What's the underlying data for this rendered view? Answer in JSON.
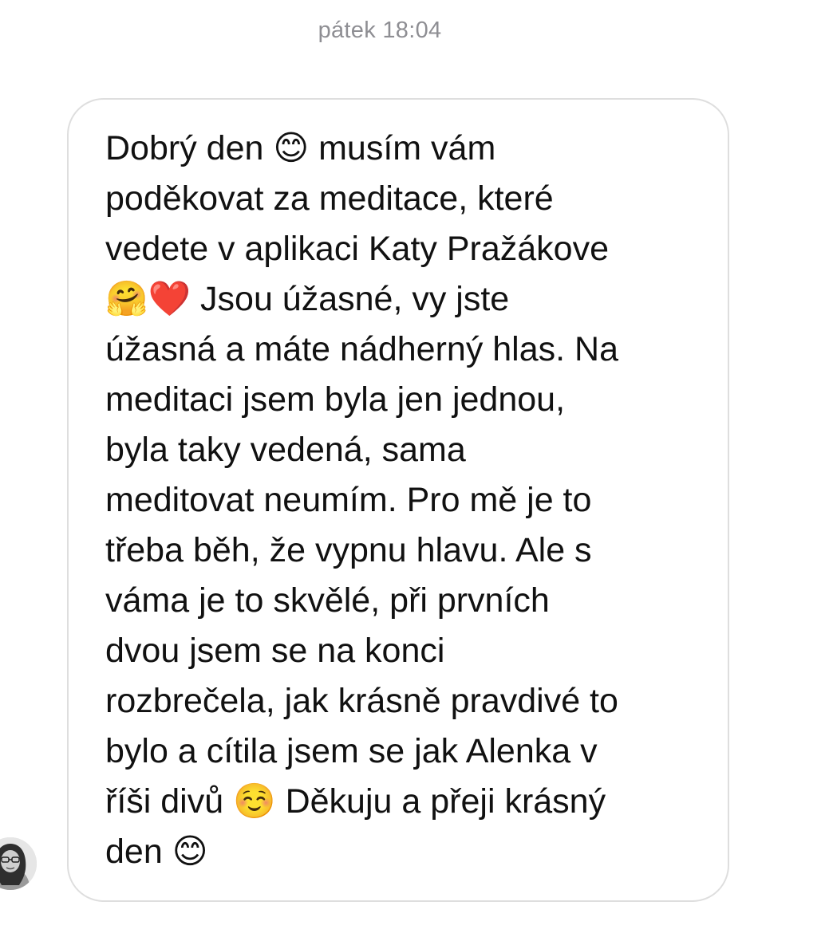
{
  "conversation": {
    "timestamp": "pátek 18:04",
    "message": {
      "text": "Dobrý den 😊 musím vám\npoděkovat za meditace, které\nvedete v aplikaci Katy Pražákove\n🤗❤️ Jsou úžasné, vy jste\núžasná a máte nádherný hlas. Na\nmeditaci jsem byla jen jednou,\nbyla taky vedená, sama\nmeditovat neumím. Pro mě je to\ntřeba běh, že vypnu hlavu. Ale s\nváma je to skvělé, při prvních\ndvou jsem se na konci\nrozbrečela, jak krásně pravdivé to\nbylo a cítila jsem se jak Alenka v\nříši divů ☺️ Děkuju a přeji krásný\nden 😊"
    },
    "sender_avatar": {
      "icon": "user-avatar-photo"
    }
  }
}
